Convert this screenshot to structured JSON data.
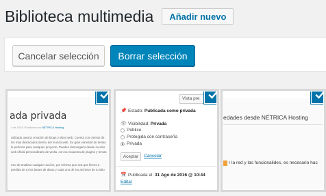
{
  "header": {
    "title": "Biblioteca multimedia",
    "add_new": "Añadir nuevo"
  },
  "toolbar": {
    "cancel_label": "Cancelar selección",
    "delete_label": "Borrar selección"
  },
  "colors": {
    "accent": "#0073aa",
    "primary_button": "#0085ba"
  },
  "tiles": [
    {
      "selected": true,
      "title": "ada privada",
      "meta_prefix": "4 de 2016 / Publicado en",
      "meta_link": "NÉTRICA Hosting",
      "para1": "utilizado para la creación de blogs y sitios web. Cuenta con cientos de los más destacados dentro del mundo web. Su gran variedad de temas le perfecta para cualquier proyecto. Puedes descargarlo desde su sitio web oficial personalizarlo de verás, con su esquema de plugins y temas",
      "para2": "etro de analizar cualquier acción, por mínima que sea que lleves a perdida de tu los bases de datos y cada uno de los archivos de tu sitio"
    },
    {
      "selected": true,
      "vista_button": "Vista pre",
      "status_label": "Estado:",
      "status_value": "Publicada como privada",
      "visibility_label": "Visibilidad:",
      "visibility_value": "Privada",
      "options": [
        "Público",
        "Protegida con contraseña",
        "Privada"
      ],
      "selected_option": "Privada",
      "accept": "Aceptar",
      "cancel": "Cancelar",
      "published_label": "Publicada el:",
      "published_value": "31 Ago de 2016 @ 10:44",
      "edit": "Editar"
    },
    {
      "selected": true,
      "title": "edades desde NÉTRICA Hosting",
      "text": "r la red y las funcionalides, es necesario hac"
    }
  ]
}
